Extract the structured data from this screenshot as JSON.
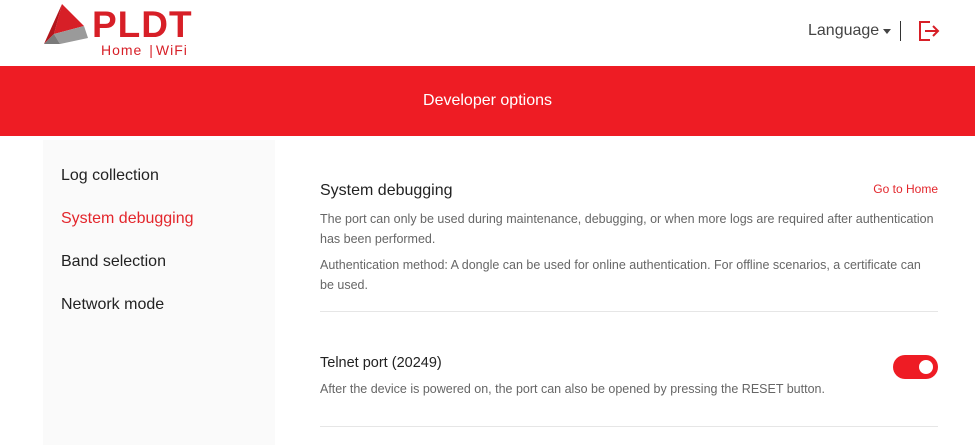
{
  "header": {
    "logo_text": "PLDT",
    "logo_sub_home": "Home",
    "logo_sub_wifi": "WiFi",
    "language_label": "Language",
    "logout_icon": "logout-icon"
  },
  "banner": {
    "title": "Developer options"
  },
  "sidebar": {
    "items": [
      {
        "label": "Log collection",
        "active": false
      },
      {
        "label": "System debugging",
        "active": true
      },
      {
        "label": "Band selection",
        "active": false
      },
      {
        "label": "Network mode",
        "active": false
      }
    ]
  },
  "main": {
    "section_title": "System debugging",
    "go_home_label": "Go to Home",
    "description_1": "The port can only be used during maintenance, debugging, or when more logs are required after authentication has been performed.",
    "description_2": "Authentication method: A dongle can be used for online authentication. For offline scenarios, a certificate can be used.",
    "telnet": {
      "title": "Telnet port (20249)",
      "description": "After the device is powered on, the port can also be opened by pressing the RESET button.",
      "enabled": true
    }
  },
  "colors": {
    "accent": "#ee1c24",
    "brand": "#d71f27",
    "active_nav": "#e3262c"
  }
}
